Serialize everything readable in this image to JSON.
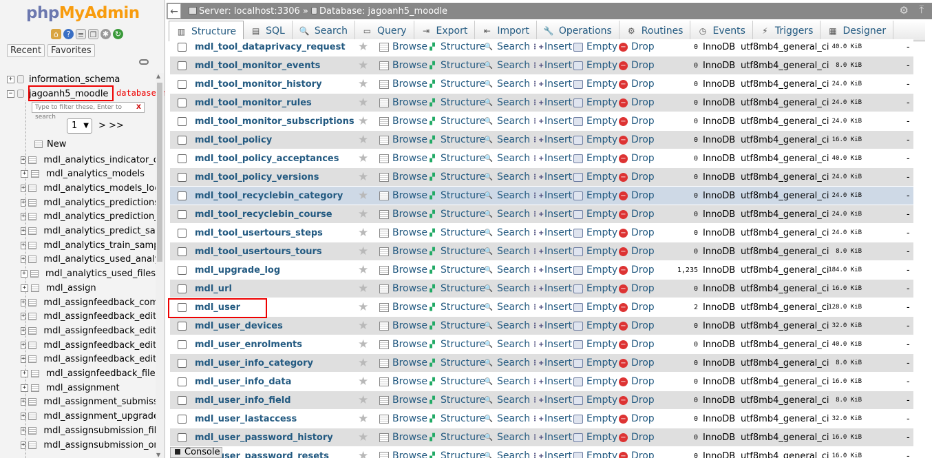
{
  "nav": {
    "logo_part1": "php",
    "logo_part2": "MyAdmin",
    "tab_recent": "Recent",
    "tab_favorites": "Favorites",
    "databases": [
      {
        "name": "information_schema",
        "expander": "+"
      },
      {
        "name": "jagoanh5_moodle",
        "expander": "−"
      }
    ],
    "annotation": "database moodle",
    "filter_placeholder": "Type to filter these, Enter to search",
    "filter_clear": "X",
    "page_select": "1",
    "page_next": "> >>",
    "new_label": "New",
    "tables": [
      "mdl_analytics_indicator_calc",
      "mdl_analytics_models",
      "mdl_analytics_models_log",
      "mdl_analytics_predictions",
      "mdl_analytics_prediction_actions",
      "mdl_analytics_predict_samples",
      "mdl_analytics_train_samples",
      "mdl_analytics_used_analysables",
      "mdl_analytics_used_files",
      "mdl_assign",
      "mdl_assignfeedback_comments",
      "mdl_assignfeedback_editpdf_annot",
      "mdl_assignfeedback_editpdf_cmnt",
      "mdl_assignfeedback_editpdf_queue",
      "mdl_assignfeedback_editpdf_quick",
      "mdl_assignfeedback_file",
      "mdl_assignment",
      "mdl_assignment_submissions",
      "mdl_assignment_upgrade",
      "mdl_assignsubmission_file",
      "mdl_assignsubmission_onlinetext"
    ]
  },
  "topbar": {
    "server": "Server: localhost:3306",
    "separator": "»",
    "database": "Database: jagoanh5_moodle"
  },
  "tabs": [
    {
      "label": "Structure",
      "icon": "structure-icon"
    },
    {
      "label": "SQL",
      "icon": "sql-icon"
    },
    {
      "label": "Search",
      "icon": "search-icon"
    },
    {
      "label": "Query",
      "icon": "query-icon"
    },
    {
      "label": "Export",
      "icon": "export-icon"
    },
    {
      "label": "Import",
      "icon": "import-icon"
    },
    {
      "label": "Operations",
      "icon": "wrench-icon"
    },
    {
      "label": "Routines",
      "icon": "routines-icon"
    },
    {
      "label": "Events",
      "icon": "clock-icon"
    },
    {
      "label": "Triggers",
      "icon": "triggers-icon"
    },
    {
      "label": "Designer",
      "icon": "designer-icon"
    }
  ],
  "actions": {
    "browse": "Browse",
    "structure": "Structure",
    "search": "Search",
    "insert": "Insert",
    "empty": "Empty",
    "drop": "Drop"
  },
  "table_rows": [
    {
      "name": "mdl_tool_dataprivacy_request",
      "rows": "0",
      "engine": "InnoDB",
      "collation": "utf8mb4_general_ci",
      "size": "40.0 KiB",
      "overhead": "-"
    },
    {
      "name": "mdl_tool_monitor_events",
      "rows": "0",
      "engine": "InnoDB",
      "collation": "utf8mb4_general_ci",
      "size": "8.0 KiB",
      "overhead": "-"
    },
    {
      "name": "mdl_tool_monitor_history",
      "rows": "0",
      "engine": "InnoDB",
      "collation": "utf8mb4_general_ci",
      "size": "24.0 KiB",
      "overhead": "-"
    },
    {
      "name": "mdl_tool_monitor_rules",
      "rows": "0",
      "engine": "InnoDB",
      "collation": "utf8mb4_general_ci",
      "size": "24.0 KiB",
      "overhead": "-"
    },
    {
      "name": "mdl_tool_monitor_subscriptions",
      "rows": "0",
      "engine": "InnoDB",
      "collation": "utf8mb4_general_ci",
      "size": "24.0 KiB",
      "overhead": "-"
    },
    {
      "name": "mdl_tool_policy",
      "rows": "0",
      "engine": "InnoDB",
      "collation": "utf8mb4_general_ci",
      "size": "16.0 KiB",
      "overhead": "-"
    },
    {
      "name": "mdl_tool_policy_acceptances",
      "rows": "0",
      "engine": "InnoDB",
      "collation": "utf8mb4_general_ci",
      "size": "40.0 KiB",
      "overhead": "-"
    },
    {
      "name": "mdl_tool_policy_versions",
      "rows": "0",
      "engine": "InnoDB",
      "collation": "utf8mb4_general_ci",
      "size": "24.0 KiB",
      "overhead": "-"
    },
    {
      "name": "mdl_tool_recyclebin_category",
      "rows": "0",
      "engine": "InnoDB",
      "collation": "utf8mb4_general_ci",
      "size": "24.0 KiB",
      "overhead": "-"
    },
    {
      "name": "mdl_tool_recyclebin_course",
      "rows": "0",
      "engine": "InnoDB",
      "collation": "utf8mb4_general_ci",
      "size": "24.0 KiB",
      "overhead": "-"
    },
    {
      "name": "mdl_tool_usertours_steps",
      "rows": "0",
      "engine": "InnoDB",
      "collation": "utf8mb4_general_ci",
      "size": "24.0 KiB",
      "overhead": "-"
    },
    {
      "name": "mdl_tool_usertours_tours",
      "rows": "0",
      "engine": "InnoDB",
      "collation": "utf8mb4_general_ci",
      "size": "8.0 KiB",
      "overhead": "-"
    },
    {
      "name": "mdl_upgrade_log",
      "rows": "1,235",
      "engine": "InnoDB",
      "collation": "utf8mb4_general_ci",
      "size": "184.0 KiB",
      "overhead": "-"
    },
    {
      "name": "mdl_url",
      "rows": "0",
      "engine": "InnoDB",
      "collation": "utf8mb4_general_ci",
      "size": "16.0 KiB",
      "overhead": "-"
    },
    {
      "name": "mdl_user",
      "rows": "2",
      "engine": "InnoDB",
      "collation": "utf8mb4_general_ci",
      "size": "128.0 KiB",
      "overhead": "-"
    },
    {
      "name": "mdl_user_devices",
      "rows": "0",
      "engine": "InnoDB",
      "collation": "utf8mb4_general_ci",
      "size": "32.0 KiB",
      "overhead": "-"
    },
    {
      "name": "mdl_user_enrolments",
      "rows": "0",
      "engine": "InnoDB",
      "collation": "utf8mb4_general_ci",
      "size": "40.0 KiB",
      "overhead": "-"
    },
    {
      "name": "mdl_user_info_category",
      "rows": "0",
      "engine": "InnoDB",
      "collation": "utf8mb4_general_ci",
      "size": "8.0 KiB",
      "overhead": "-"
    },
    {
      "name": "mdl_user_info_data",
      "rows": "0",
      "engine": "InnoDB",
      "collation": "utf8mb4_general_ci",
      "size": "16.0 KiB",
      "overhead": "-"
    },
    {
      "name": "mdl_user_info_field",
      "rows": "0",
      "engine": "InnoDB",
      "collation": "utf8mb4_general_ci",
      "size": "8.0 KiB",
      "overhead": "-"
    },
    {
      "name": "mdl_user_lastaccess",
      "rows": "0",
      "engine": "InnoDB",
      "collation": "utf8mb4_general_ci",
      "size": "32.0 KiB",
      "overhead": "-"
    },
    {
      "name": "mdl_user_password_history",
      "rows": "0",
      "engine": "InnoDB",
      "collation": "utf8mb4_general_ci",
      "size": "16.0 KiB",
      "overhead": "-"
    },
    {
      "name": "mdl_user_password_resets",
      "rows": "0",
      "engine": "InnoDB",
      "collation": "utf8mb4_general_ci",
      "size": "16.0 KiB",
      "overhead": "-"
    }
  ],
  "console_label": "Console",
  "colors": {
    "link": "#235a81",
    "highlight_box": "#ee0000",
    "row_alt": "#dfdfdf",
    "row_hover": "#ced9e6"
  }
}
